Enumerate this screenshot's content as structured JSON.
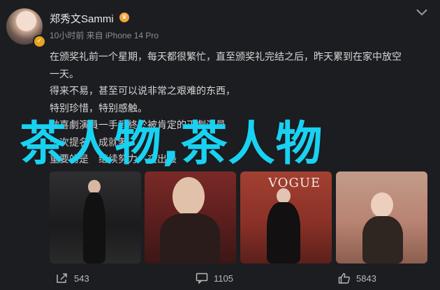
{
  "header": {
    "username": "郑秀文Sammi",
    "meta": "10小时前  来自 iPhone 14 Pro"
  },
  "body": {
    "lines": [
      "在颁奖礼前一个星期，每天都很繁忙，直至颁奖礼完结之后，昨天累到在家中放空",
      "一天。",
      "得来不易，甚至可以说非常之艰难的东西，",
      "特别珍惜，特别感触。",
      "做喜劇演員一手到終於被肯定的正劇演員",
      "十次提名　成就著",
      "重要的是　继续努力　交出最"
    ]
  },
  "watermark": "茶人物,茶人物",
  "photos": [
    {
      "label": "photo-1"
    },
    {
      "label": "photo-2"
    },
    {
      "label": "photo-3",
      "sign": "VOGUE"
    },
    {
      "label": "photo-4"
    }
  ],
  "footer": {
    "share_count": "543",
    "comment_count": "1105",
    "like_count": "5843"
  },
  "icons": {
    "share": "share-icon",
    "comment": "comment-icon",
    "like": "thumbs-up-icon",
    "more": "chevron-down-icon"
  },
  "colors": {
    "background": "#1c1d21",
    "watermark": "#19d1f0",
    "text": "#d6d6d6",
    "meta": "#8e8e93"
  }
}
